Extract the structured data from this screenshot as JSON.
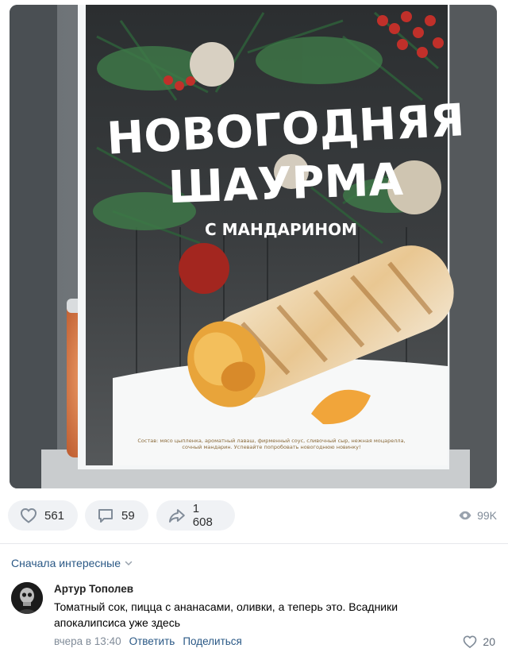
{
  "post": {
    "image": {
      "poster_title_line1": "НОВОГОДНЯЯ",
      "poster_title_line2": "ШАУРМА",
      "poster_subtitle": "С МАНДАРИНОМ",
      "poster_fineprint_line1": "Состав: мясо цыпленка, ароматный лаваш, фирменный соус, сливочный сыр, нежная моцарелла,",
      "poster_fineprint_line2": "сочный мандарин. Успевайте попробовать новогоднюю новинку!"
    },
    "actions": {
      "likes": "561",
      "comments": "59",
      "shares": "1 608",
      "views": "99K"
    }
  },
  "comments_section": {
    "sort_label": "Сначала интересные",
    "items": [
      {
        "author": "Артур Тополев",
        "text": "Томатный сок, пицца с ананасами, оливки, а теперь это. Всадники апокалипсиса уже здесь",
        "time": "вчера в 13:40",
        "reply_label": "Ответить",
        "share_label": "Поделиться",
        "likes": "20"
      }
    ]
  },
  "colors": {
    "link": "#2a5885",
    "muted": "#818c99",
    "pill_bg": "#f0f2f5",
    "icon": "#99a2ad"
  }
}
